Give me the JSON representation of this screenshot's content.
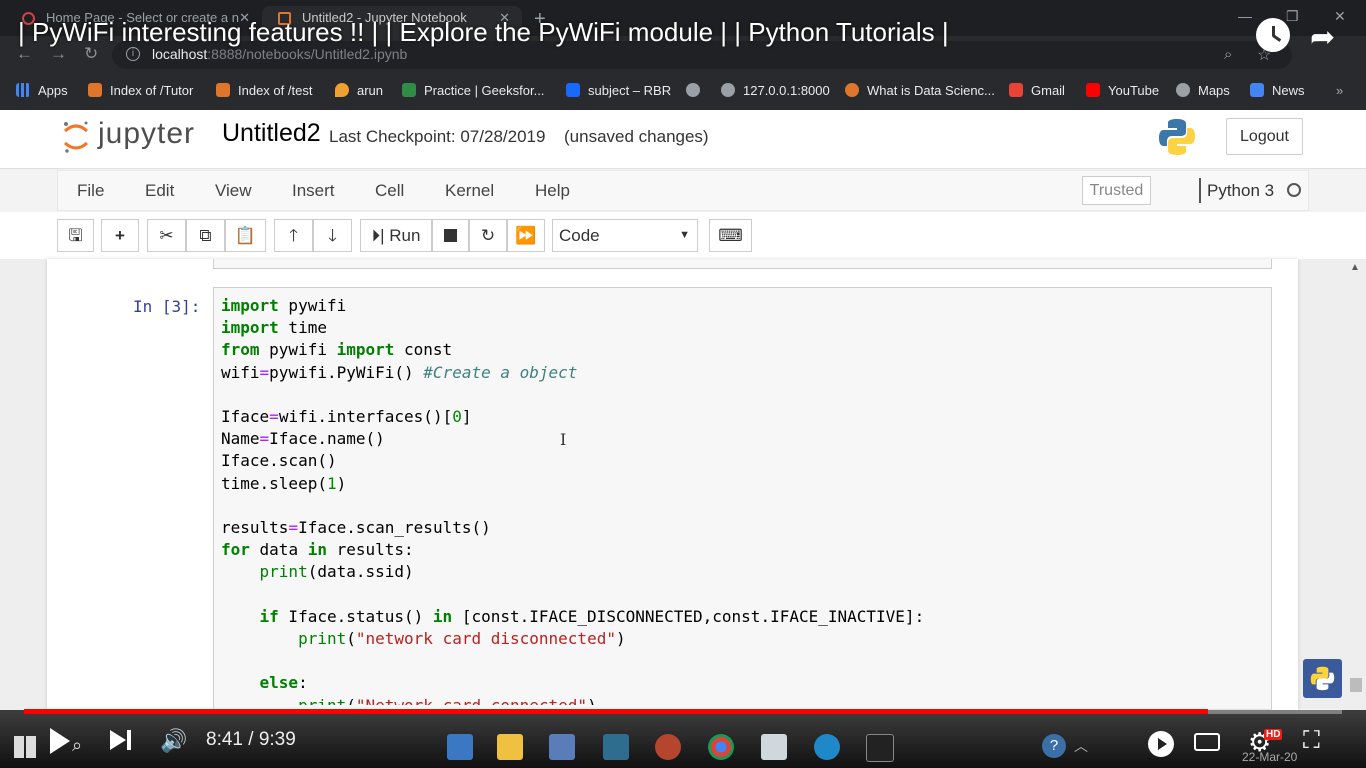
{
  "browser": {
    "tabs": [
      {
        "label": "Home Page - Select or create a n"
      },
      {
        "label": "Untitled2 - Jupyter Notebook"
      }
    ],
    "url_host": "localhost",
    "url_path": ":8888/notebooks/Untitled2.ipynb",
    "bookmarks": [
      {
        "label": "Apps",
        "color": "#4285f4"
      },
      {
        "label": "Index of /Tutor",
        "color": "#e0762b"
      },
      {
        "label": "Index of /test",
        "color": "#e0762b"
      },
      {
        "label": "arun",
        "color": "#f0a030"
      },
      {
        "label": "Practice | Geeksfor...",
        "color": "#2f8d46"
      },
      {
        "label": "subject – RBR",
        "color": "#1769ff"
      },
      {
        "label": "",
        "color": "#9aa0a6"
      },
      {
        "label": "127.0.0.1:8000",
        "color": "#9aa0a6"
      },
      {
        "label": "What is Data Scienc...",
        "color": "#e0762b"
      },
      {
        "label": "Gmail",
        "color": "#ea4335"
      },
      {
        "label": "YouTube",
        "color": "#ff0000"
      },
      {
        "label": "Maps",
        "color": "#9aa0a6"
      },
      {
        "label": "News",
        "color": "#4285f4"
      }
    ]
  },
  "video": {
    "title": "| PyWiFi interesting features !! | | Explore the PyWiFi module | | Python Tutorials |",
    "time_display": "8:41 / 9:39",
    "progress": 0.898,
    "hd_label": "HD",
    "date_partial": "22-Mar-20"
  },
  "jupyter": {
    "logo_text": "jupyter",
    "notebook_name": "Untitled2",
    "checkpoint": "Last Checkpoint: 07/28/2019",
    "unsaved": "(unsaved changes)",
    "logout_label": "Logout",
    "menu": [
      "File",
      "Edit",
      "View",
      "Insert",
      "Cell",
      "Kernel",
      "Help"
    ],
    "trusted_label": "Trusted",
    "kernel_name": "Python 3",
    "run_label": "Run",
    "cell_type": "Code",
    "cell_prompt": "In [3]:"
  },
  "code_lines": [
    "import pywifi",
    "import time",
    "from pywifi import const",
    "wifi=pywifi.PyWiFi() #Create a object",
    "",
    "Iface=wifi.interfaces()[0]",
    "Name=Iface.name()",
    "Iface.scan()",
    "time.sleep(1)",
    "",
    "results=Iface.scan_results()",
    "for data in results:",
    "    print(data.ssid)",
    "",
    "    if Iface.status() in [const.IFACE_DISCONNECTED,const.IFACE_INACTIVE]:",
    "        print(\"network card disconnected\")",
    "",
    "    else:",
    "        print(\"Network card connected\")"
  ]
}
